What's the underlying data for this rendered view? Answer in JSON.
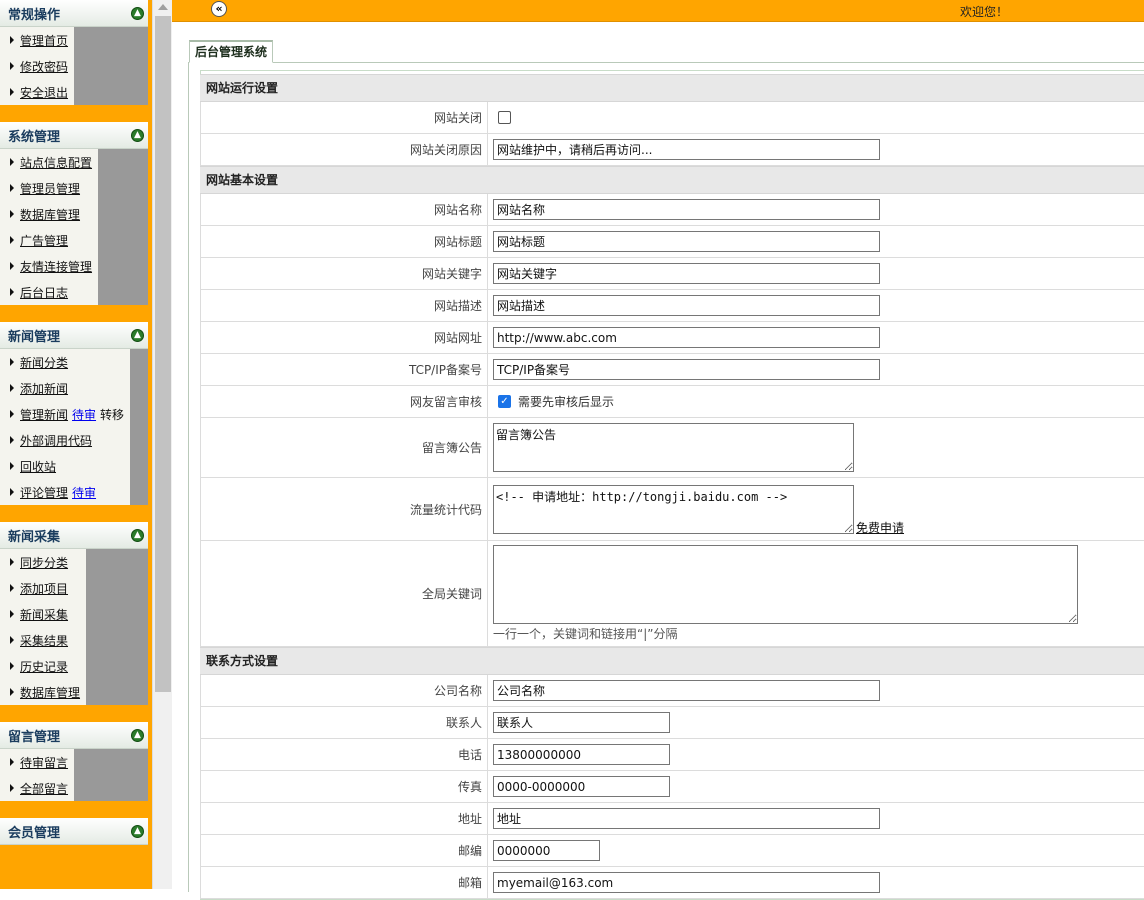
{
  "sidebar": {
    "groups": [
      {
        "title": "常规操作",
        "items": [
          {
            "label": "管理首页"
          },
          {
            "label": "修改密码"
          },
          {
            "label": "安全退出"
          }
        ]
      },
      {
        "title": "系统管理",
        "items": [
          {
            "label": "站点信息配置"
          },
          {
            "label": "管理员管理"
          },
          {
            "label": "数据库管理"
          },
          {
            "label": "广告管理"
          },
          {
            "label": "友情连接管理"
          },
          {
            "label": "后台日志"
          }
        ]
      },
      {
        "title": "新闻管理",
        "items": [
          {
            "label": "新闻分类"
          },
          {
            "label": "添加新闻"
          },
          {
            "label": "管理新闻",
            "extra": "待审",
            "extra2": "转移"
          },
          {
            "label": "外部调用代码"
          },
          {
            "label": "回收站"
          },
          {
            "label": "评论管理",
            "extra": "待审"
          }
        ]
      },
      {
        "title": "新闻采集",
        "items": [
          {
            "label": "同步分类"
          },
          {
            "label": "添加项目"
          },
          {
            "label": "新闻采集"
          },
          {
            "label": "采集结果"
          },
          {
            "label": "历史记录"
          },
          {
            "label": "数据库管理"
          }
        ]
      },
      {
        "title": "留言管理",
        "items": [
          {
            "label": "待审留言"
          },
          {
            "label": "全部留言"
          }
        ]
      },
      {
        "title": "会员管理",
        "items": []
      }
    ]
  },
  "topbar": {
    "welcome": "欢迎您！",
    "collapse_icon": "double-chevron-left-icon"
  },
  "tab": {
    "label": "后台管理系统"
  },
  "form": {
    "run_section": "网站运行设置",
    "site_closed_label": "网站关闭",
    "close_reason_label": "网站关闭原因",
    "close_reason_value": "网站维护中，请稍后再访问...",
    "basic_section": "网站基本设置",
    "site_name_label": "网站名称",
    "site_name_value": "网站名称",
    "site_title_label": "网站标题",
    "site_title_value": "网站标题",
    "keywords_label": "网站关键字",
    "keywords_value": "网站关键字",
    "desc_label": "网站描述",
    "desc_value": "网站描述",
    "url_label": "网站网址",
    "url_value": "http://www.abc.com",
    "icp_label": "TCP/IP备案号",
    "icp_value": "TCP/IP备案号",
    "audit_label": "网友留言审核",
    "audit_text": "需要先审核后显示",
    "guestbook_label": "留言簿公告",
    "guestbook_value": "留言簿公告",
    "stats_label": "流量统计代码",
    "stats_value": "<!-- 申请地址：http://tongji.baidu.com -->",
    "stats_link": "免费申请",
    "global_kw_label": "全局关键词",
    "global_kw_value": "",
    "global_kw_note": "一行一个，关键词和链接用“|”分隔",
    "contact_section": "联系方式设置",
    "company_label": "公司名称",
    "company_value": "公司名称",
    "contact_label": "联系人",
    "contact_value": "联系人",
    "phone_label": "电话",
    "phone_value": "13800000000",
    "fax_label": "传真",
    "fax_value": "0000-0000000",
    "address_label": "地址",
    "address_value": "地址",
    "zip_label": "邮编",
    "zip_value": "0000000",
    "email_label": "邮箱",
    "email_value": "myemail@163.com"
  },
  "colors": {
    "accent": "#ffa500",
    "sidebar_body": "#999999",
    "section_bg": "#e8e8e8"
  }
}
